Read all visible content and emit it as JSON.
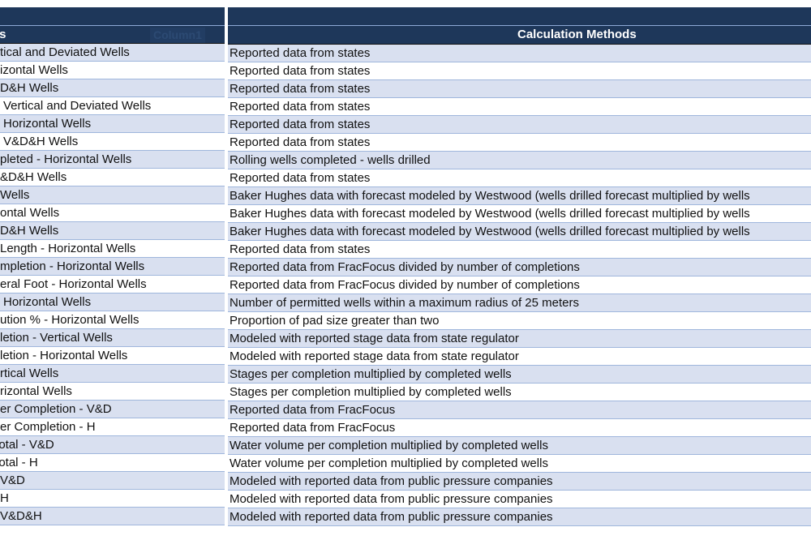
{
  "table": {
    "headings_header": "Headings",
    "ghost_header": "Column1",
    "methods_header": "Calculation Methods",
    "rows": [
      {
        "heading": "Vertical and Deviated Wells",
        "method": "Reported data from states"
      },
      {
        "heading": "Horizontal Wells",
        "method": "Reported data from states"
      },
      {
        "heading": "V&D&H Wells",
        "method": "Reported data from states"
      },
      {
        "heading": "- Vertical and Deviated Wells",
        "method": "Reported data from states"
      },
      {
        "heading": "- Horizontal Wells",
        "method": "Reported data from states"
      },
      {
        "heading": "- V&D&H Wells",
        "method": "Reported data from states"
      },
      {
        "heading": "Completed - Horizontal Wells",
        "method": "Rolling wells completed - wells drilled"
      },
      {
        "heading": "V&D&H Wells",
        "method": "Reported data from states"
      },
      {
        "heading": "Wells",
        "method": "Baker Hughes data with forecast modeled by Westwood (wells drilled forecast multiplied by wells"
      },
      {
        "heading": "Horizontal Wells",
        "method": "Baker Hughes data with forecast modeled by Westwood (wells drilled forecast multiplied by wells"
      },
      {
        "heading": "V&D&H Wells",
        "method": "Baker Hughes data with forecast modeled by Westwood (wells drilled forecast multiplied by wells"
      },
      {
        "heading": "Lateral Length - Horizontal Wells",
        "method": "Reported data from states"
      },
      {
        "heading": "per Completion - Horizontal Wells",
        "method": "Reported data from FracFocus divided by number of completions"
      },
      {
        "heading": "per Lateral Foot - Horizontal Wells",
        "method": "Reported data from FracFocus divided by number of completions"
      },
      {
        "heading": "- Horizontal Wells",
        "method": "Number of permitted wells within a maximum radius of 25 meters"
      },
      {
        "heading": "Distribution % - Horizontal Wells",
        "method": "Proportion of pad size greater than two"
      },
      {
        "heading": "Completion - Vertical Wells",
        "method": "Modeled with reported stage data from state regulator"
      },
      {
        "heading": "Completion - Horizontal Wells",
        "method": "Modeled with reported stage data from state regulator"
      },
      {
        "heading": "Vertical Wells",
        "method": "Stages per completion multiplied by completed wells"
      },
      {
        "heading": "Horizontal Wells",
        "method": "Stages per completion multiplied by completed wells"
      },
      {
        "heading": "per Completion - V&D",
        "method": "Reported data from FracFocus"
      },
      {
        "heading": "per Completion - H",
        "method": "Reported data from FracFocus"
      },
      {
        "heading": "Total - V&D",
        "method": "Water volume per completion multiplied by completed wells"
      },
      {
        "heading": "Total - H",
        "method": "Water volume per completion multiplied by completed wells"
      },
      {
        "heading": "V&D",
        "method": "Modeled with reported data from public pressure companies"
      },
      {
        "heading": "H",
        "method": "Modeled with reported data from public pressure companies"
      },
      {
        "heading": "V&D&H",
        "method": "Modeled with reported data from public pressure companies"
      }
    ]
  }
}
